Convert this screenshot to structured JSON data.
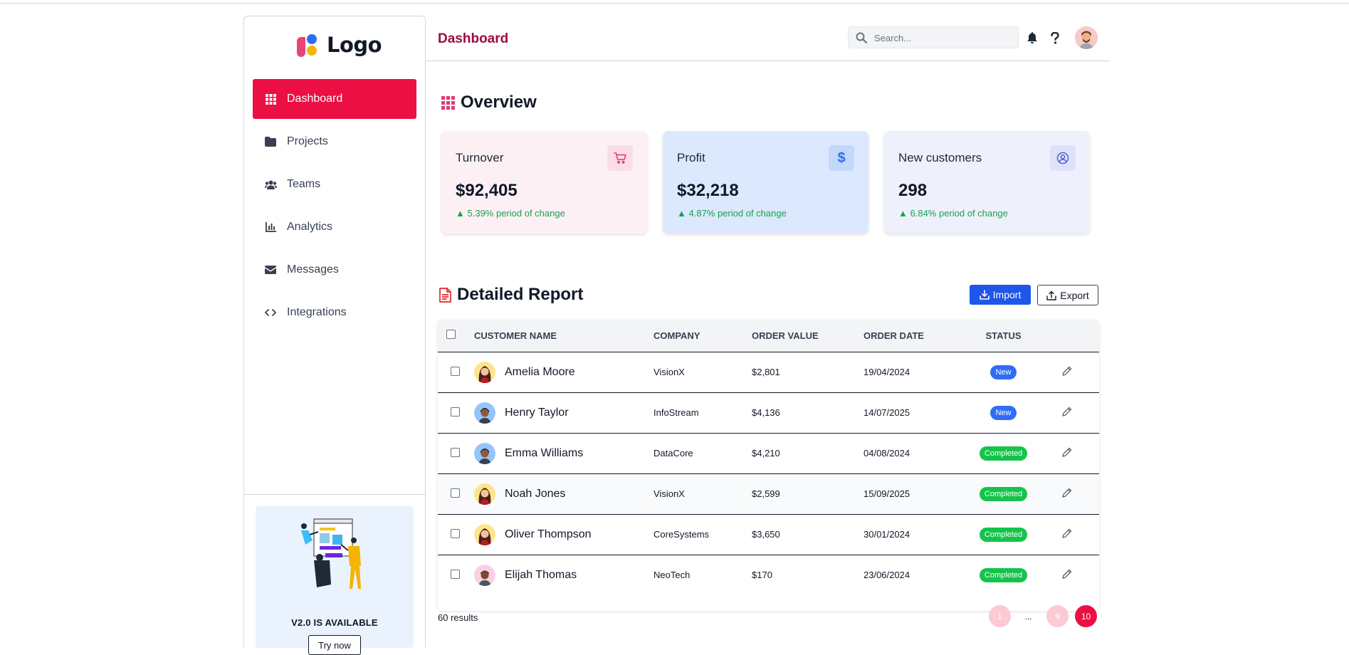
{
  "brand": {
    "logo_text": "Logo"
  },
  "sidebar": {
    "items": [
      {
        "label": "Dashboard",
        "icon": "grid-icon",
        "active": true
      },
      {
        "label": "Projects",
        "icon": "folder-icon"
      },
      {
        "label": "Teams",
        "icon": "users-icon"
      },
      {
        "label": "Analytics",
        "icon": "bar-chart-icon"
      },
      {
        "label": "Messages",
        "icon": "envelope-icon"
      },
      {
        "label": "Integrations",
        "icon": "code-icon"
      }
    ],
    "promo": {
      "title": "V2.0 IS AVAILABLE",
      "button": "Try now"
    }
  },
  "header": {
    "title": "Dashboard",
    "search_placeholder": "Search...",
    "icons": [
      "bell-icon",
      "help-icon",
      "avatar"
    ]
  },
  "overview": {
    "title": "Overview",
    "cards": [
      {
        "title": "Turnover",
        "value": "$92,405",
        "change": "5.39% period of change",
        "icon": "cart-icon",
        "bg": "#fdf0f4",
        "icon_bg": "#fbdde6",
        "icon_color": "#e23a76"
      },
      {
        "title": "Profit",
        "value": "$32,218",
        "change": "4.87% period of change",
        "icon": "dollar-icon",
        "bg": "#dce8fd",
        "icon_bg": "#c4d8fb",
        "icon_color": "#2f6df6"
      },
      {
        "title": "New customers",
        "value": "298",
        "change": "6.84% period of change",
        "icon": "user-circle-icon",
        "bg": "#eef0fc",
        "icon_bg": "#dde2fa",
        "icon_color": "#4f62d8"
      }
    ]
  },
  "report": {
    "title": "Detailed Report",
    "import_label": "Import",
    "export_label": "Export",
    "columns": [
      "CUSTOMER NAME",
      "COMPANY",
      "ORDER VALUE",
      "ORDER DATE",
      "STATUS"
    ],
    "rows": [
      {
        "name": "Amelia Moore",
        "company": "VisionX",
        "value": "$2,801",
        "date": "19/04/2024",
        "status": "New"
      },
      {
        "name": "Henry Taylor",
        "company": "InfoStream",
        "value": "$4,136",
        "date": "14/07/2025",
        "status": "New"
      },
      {
        "name": "Emma Williams",
        "company": "DataCore",
        "value": "$4,210",
        "date": "04/08/2024",
        "status": "Completed"
      },
      {
        "name": "Noah Jones",
        "company": "VisionX",
        "value": "$2,599",
        "date": "15/09/2025",
        "status": "Completed"
      },
      {
        "name": "Oliver Thompson",
        "company": "CoreSystems",
        "value": "$3,650",
        "date": "30/01/2024",
        "status": "Completed"
      },
      {
        "name": "Elijah Thomas",
        "company": "NeoTech",
        "value": "$170",
        "date": "23/06/2024",
        "status": "Completed"
      }
    ],
    "results": "60 results",
    "pagination": [
      "1",
      "...",
      "9",
      "10"
    ],
    "current_page": "10"
  },
  "colors": {
    "accent": "#ec0f44",
    "title": "#9d0a43",
    "import": "#1d56e8",
    "positive": "#16a34a"
  }
}
